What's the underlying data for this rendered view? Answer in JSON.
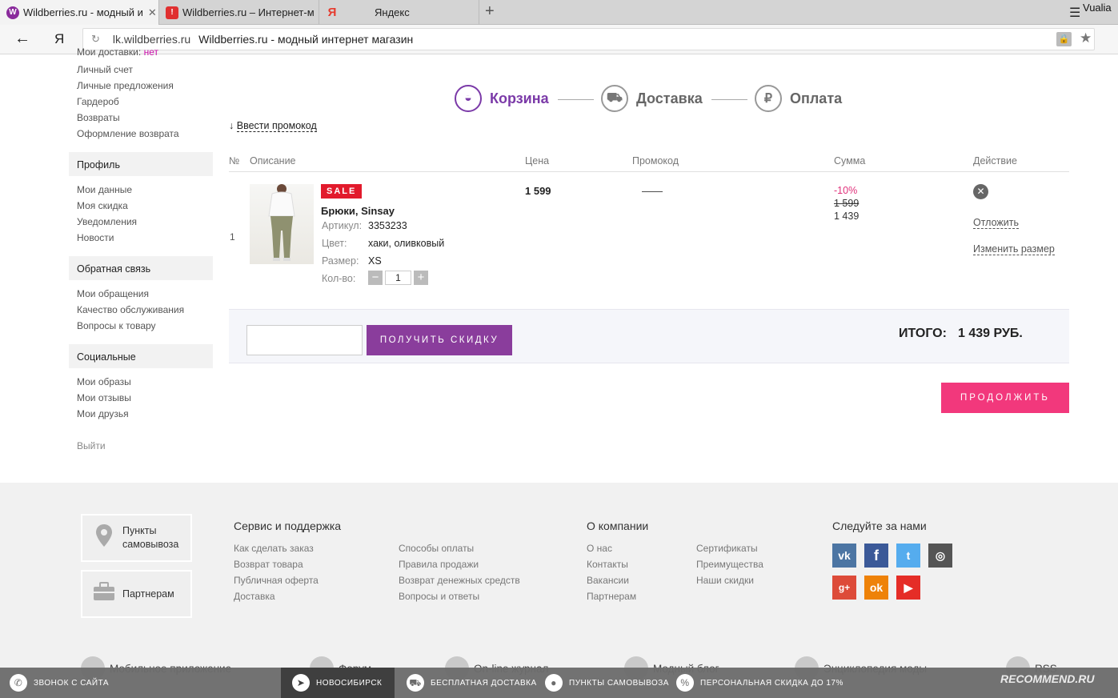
{
  "browser": {
    "tabs": [
      {
        "title": "Wildberries.ru - модный и",
        "fav": "W",
        "fav_color": "#8a2b9c"
      },
      {
        "title": "Wildberries.ru – Интернет-м",
        "fav": "!",
        "fav_color": "#e03030"
      },
      {
        "title": "Яндекс",
        "fav": "Я",
        "fav_color": "#e63b2e"
      }
    ],
    "new_tab": "+",
    "user": "Vualia",
    "back": "←",
    "ya": "Я",
    "reload": "↻",
    "url_host": "lk.wildberries.ru",
    "url_title": "Wildberries.ru - модный интернет магазин"
  },
  "sidebar": {
    "cut_item": "Мои доставки",
    "cut_badge": "нет",
    "group1": [
      "Личный счет",
      "Личные предложения",
      "Гардероб",
      "Возвраты",
      "Оформление возврата"
    ],
    "profile_header": "Профиль",
    "profile": [
      "Мои данные",
      "Моя скидка",
      "Уведомления",
      "Новости"
    ],
    "feedback_header": "Обратная связь",
    "feedback": [
      "Мои обращения",
      "Качество обслуживания",
      "Вопросы к товару"
    ],
    "social_header": "Социальные",
    "social": [
      "Мои образы",
      "Мои отзывы",
      "Мои друзья"
    ],
    "logout": "Выйти"
  },
  "steps": [
    {
      "label": "Корзина",
      "icon": "basket-icon",
      "glyph": "◒"
    },
    {
      "label": "Доставка",
      "icon": "truck-icon",
      "glyph": "⛟"
    },
    {
      "label": "Оплата",
      "icon": "ruble-icon",
      "glyph": "₽"
    }
  ],
  "promo_link": "Ввести промокод",
  "table": {
    "headers": {
      "num": "№",
      "desc": "Описание",
      "price": "Цена",
      "promo": "Промокод",
      "sum": "Сумма",
      "action": "Действие"
    },
    "row": {
      "num": "1",
      "badge": "SALE",
      "name": "Брюки, Sinsay",
      "article_label": "Артикул:",
      "article": "3353233",
      "color_label": "Цвет:",
      "color": "хаки, оливковый",
      "size_label": "Размер:",
      "size": "XS",
      "qty_label": "Кол-во:",
      "qty": "1",
      "price": "1 599",
      "promo": "——",
      "discount": "-10%",
      "old_price": "1 599",
      "new_price": "1 439",
      "postpone": "Отложить",
      "change_size": "Изменить размер"
    }
  },
  "summary": {
    "get_discount": "ПОЛУЧИТЬ СКИДКУ",
    "total_label": "ИТОГО:",
    "total_value": "1 439 РУБ.",
    "continue": "ПРОДОЛЖИТЬ"
  },
  "footer": {
    "pickup": "Пункты самовывоза",
    "partners_box": "Партнерам",
    "service_header": "Сервис и поддержка",
    "service_col1": [
      "Как сделать заказ",
      "Возврат товара",
      "Публичная оферта",
      "Доставка"
    ],
    "service_col2": [
      "Способы оплаты",
      "Правила продажи",
      "Возврат денежных средств",
      "Вопросы и ответы"
    ],
    "about_header": "О компании",
    "about_col1": [
      "О нас",
      "Контакты",
      "Вакансии",
      "Партнерам"
    ],
    "about_col2": [
      "Сертификаты",
      "Преимущества",
      "Наши скидки"
    ],
    "follow_header": "Следуйте за нами",
    "social_colors": {
      "vk": "#4c75a3",
      "fb": "#3b5998",
      "tw": "#55acee",
      "ig": "#555555",
      "gp": "#dd4b39",
      "ok": "#ee8208",
      "yt": "#e52d27"
    },
    "bottom_links": [
      "Мобильное приложение",
      "Форум",
      "On-line журнал",
      "Модный блог",
      "Энциклопедия моды",
      "RSS"
    ]
  },
  "bottom_bar": {
    "call": "звонок с сайта",
    "city": "новосибирск",
    "delivery": "бесплатная доставка",
    "pickup": "пункты самовывоза",
    "discount": "персональная скидка до 17%"
  },
  "watermark": "RECOMMEND.RU"
}
